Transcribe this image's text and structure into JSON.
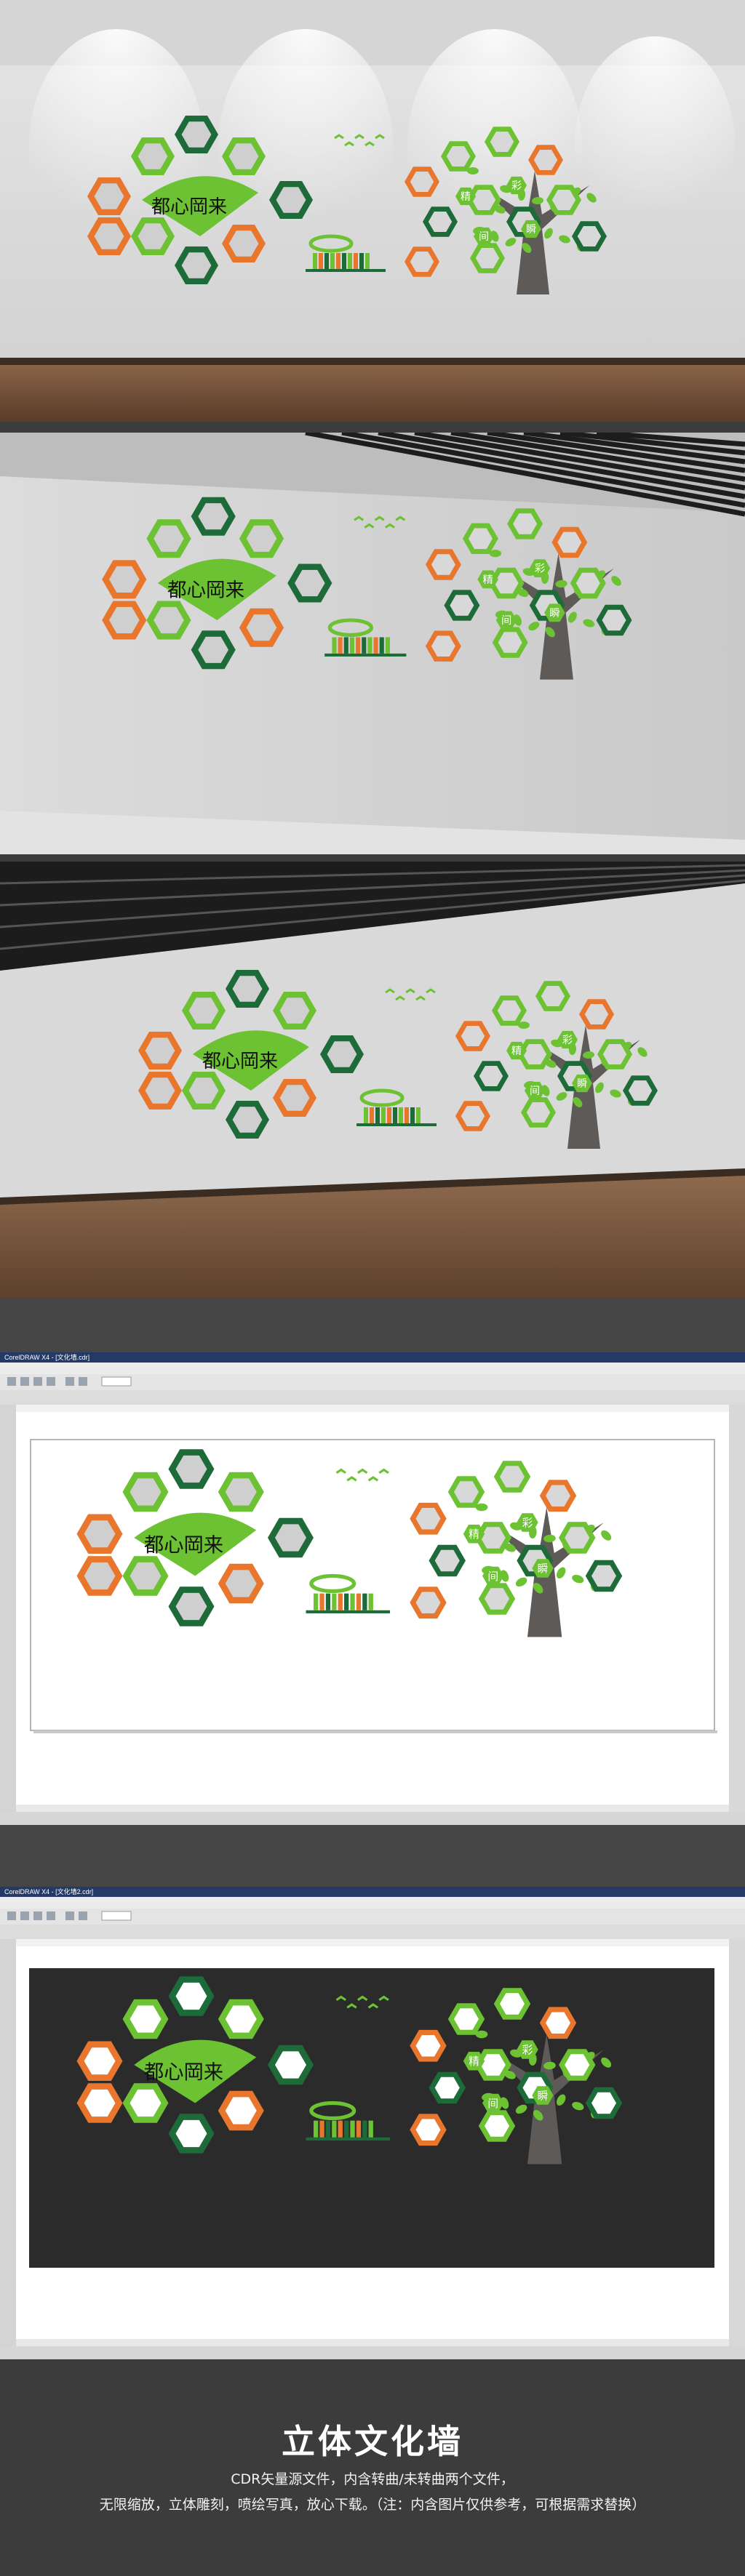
{
  "colors": {
    "green": "#6cc233",
    "dark_green": "#1e6b3a",
    "orange": "#e8762d",
    "charcoal": "#2b2b2b",
    "trunk": "#5d5a58",
    "background": "#3c3c3c"
  },
  "wall": {
    "calligraphy": "都心岡来",
    "tree_chars": [
      "精",
      "彩",
      "瞬",
      "间"
    ]
  },
  "software_window": {
    "title_a": "CorelDRAW X4 - [文化墙.cdr]",
    "title_b": "CorelDRAW X4 - [文化墙2.cdr]"
  },
  "footer": {
    "title": "立体文化墙",
    "line1": "CDR矢量源文件，内含转曲/未转曲两个文件，",
    "line2": "无限缩放，立体雕刻，喷绘写真，放心下载。（注：内含图片仅供参考，可根据需求替换）"
  }
}
